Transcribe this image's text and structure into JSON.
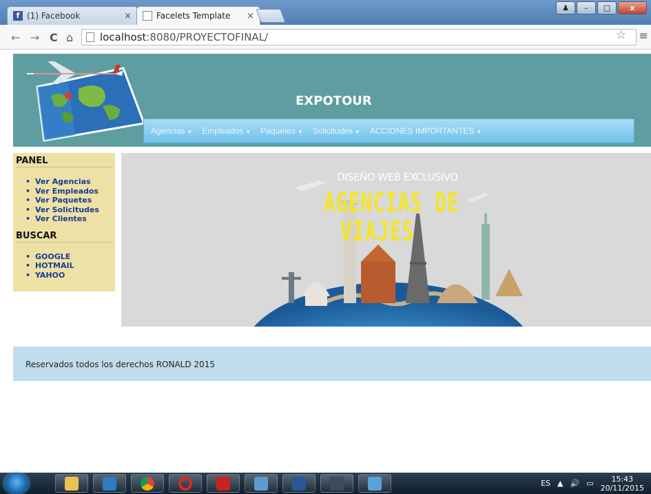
{
  "browser": {
    "tabs": [
      {
        "label": "(1) Facebook",
        "icon": "facebook-icon",
        "active": false
      },
      {
        "label": "Facelets Template",
        "icon": "page-icon",
        "active": true
      }
    ],
    "address": {
      "host": "localhost",
      "path": ":8080/PROYECTOFINAL/"
    },
    "window_controls": {
      "minimize": "–",
      "maximize": "□",
      "close": "x",
      "user": "♟"
    },
    "nav": {
      "back": "←",
      "forward": "→",
      "reload": "C",
      "home": "⌂",
      "bookmark": "☆",
      "menu": "≡"
    }
  },
  "page": {
    "title": "EXPOTOUR",
    "menu": [
      {
        "label": "Agencias"
      },
      {
        "label": "Empleados"
      },
      {
        "label": "Paquetes"
      },
      {
        "label": "Solicitudes"
      },
      {
        "label": "ACCIONES IMPORTANTES"
      }
    ],
    "sidebar": {
      "panel_title": "PANEL",
      "panel_links": [
        "Ver Agencias",
        "Ver Empleados",
        "Ver Paquetes",
        "Ver Solicitudes",
        "Ver Clientes"
      ],
      "search_title": "BUSCAR",
      "search_links": [
        "GOOGLE",
        "HOTMAIL",
        "YAHOO"
      ]
    },
    "banner": {
      "subtitle": "DISEÑO WEB EXCLUSIVO",
      "line1": "AGENCIAS DE",
      "line2": "VIAJES"
    },
    "footer": "Reservados todos los derechos RONALD 2015"
  },
  "taskbar": {
    "apps": [
      "explorer-icon",
      "media-icon",
      "chrome-icon",
      "opera-icon",
      "acrobat-icon",
      "screenshot-icon",
      "word-icon",
      "sql-icon",
      "virtualbox-icon"
    ],
    "language": "ES",
    "time": "15:43",
    "date": "20/11/2015"
  },
  "colors": {
    "header_bg": "#5f9ea0",
    "menu_bg": "#6fc1ea",
    "sidebar_bg": "#eee1a6",
    "link": "#1a3a8f",
    "banner_text": "#f6e524",
    "footer_bg": "#c0dded"
  }
}
